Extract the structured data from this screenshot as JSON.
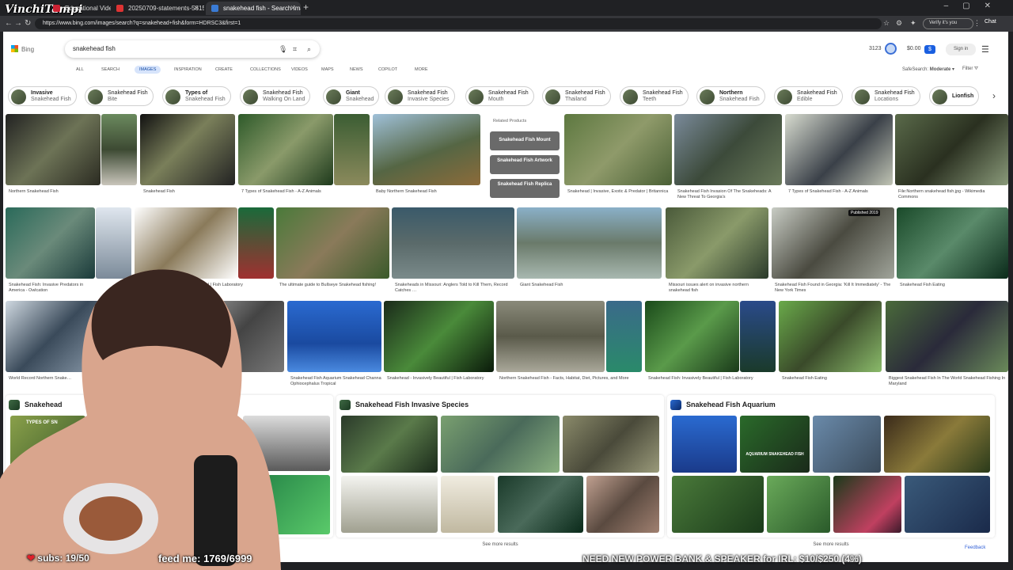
{
  "browser": {
    "tabs": [
      {
        "label": "Educational Video Questions and …"
      },
      {
        "label": "20250709-statements-5615-.pdf"
      },
      {
        "label": "snakehead fish - Search Images"
      }
    ],
    "url": "https://www.bing.com/images/search?q=snakehead+fish&form=HDRSC3&first=1",
    "verify_label": "Verify it's you",
    "chat_label": "Chat"
  },
  "bing": {
    "logo_label": "Bing",
    "query": "snakehead fish",
    "points": "3123",
    "balance": "$0.00",
    "signin": "Sign in",
    "scopes": [
      "ALL",
      "SEARCH",
      "IMAGES",
      "Inspiration",
      "Create",
      "Collections",
      "VIDEOS",
      "MAPS",
      "NEWS",
      "COPILOT",
      "MORE"
    ],
    "safesearch_label": "SafeSearch:",
    "safesearch_value": "Moderate",
    "filter_label": "Filter"
  },
  "pills": [
    {
      "a": "Invasive",
      "b": "Snakehead Fish"
    },
    {
      "a": "Snakehead Fish",
      "b": "Bite"
    },
    {
      "a": "Types of",
      "b": "Snakehead Fish"
    },
    {
      "a": "Snakehead Fish",
      "b": "Walking On Land"
    },
    {
      "a": "Giant",
      "b": "Snakehead"
    },
    {
      "a": "Snakehead Fish",
      "b": "Invasive Species"
    },
    {
      "a": "Snakehead Fish",
      "b": "Mouth"
    },
    {
      "a": "Snakehead Fish",
      "b": "Thailand"
    },
    {
      "a": "Snakehead Fish",
      "b": "Teeth"
    },
    {
      "a": "Northern",
      "b": "Snakehead Fish"
    },
    {
      "a": "Snakehead Fish",
      "b": "Edible"
    },
    {
      "a": "Snakehead Fish",
      "b": "Locations"
    },
    {
      "a": "Lionfish",
      "b": ""
    }
  ],
  "related": {
    "header": "Related Products",
    "items": [
      "Snakehead Fish Mount",
      "Snakehead Fish Artwork",
      "Snakehead Fish Replica"
    ]
  },
  "captions": {
    "r1": [
      "Northern Snakehead Fish",
      "Snakehead Fish",
      "7 Types of Snakehead Fish - A-Z Animals",
      "Baby Northern Snakehead Fish",
      "Snakehead | Invasive, Exotic & Predator | Britannica",
      "Snakehead Fish Invasion Of The Snakeheads: A New Threat To Georgia's",
      "7 Types of Snakehead Fish - A-Z Animals",
      "File:Northern snakehead fish.jpg - Wikimedia Commons"
    ],
    "r2": [
      "Snakehead Fish: Invasive Predators in America - Owlcation",
      "…autiful | Fish Laboratory",
      "The ultimate guide to Bullseye Snakehead fishing!",
      "Snakeheads in Missouri: Anglers Told to Kill Them, Record Catches …",
      "Giant Snakehead Fish",
      "Missouri issues alert on invasive northern snakehead fish",
      "Snakehead Fish Found in Georgia: 'Kill It Immediately' - The New York Times",
      "Snakehead Fish Eating"
    ],
    "r3": [
      "World Record Northern Snake…",
      "Snakehead Fish Aquarium Snakehead Channa Ophiocephalus Tropical",
      "Snakehead - Invasively Beautiful | Fish Laboratory",
      "Northern Snakehead Fish - Facts, Habitat, Diet, Pictures, and More",
      "Snakehead Fish: Invasively Beautiful | Fish Laboratory",
      "Snakehead Fish Eating",
      "Biggest Snakehead Fish In The World Snakehead Fishing In Maryland"
    ]
  },
  "badge": "Published 2019",
  "cards": [
    {
      "title": "Snakehead",
      "more": ""
    },
    {
      "title": "Snakehead Fish Invasive Species",
      "more": "See more results"
    },
    {
      "title": "Snakehead Fish Aquarium",
      "more": "See more results"
    }
  ],
  "card_image_labels": {
    "types_text": "TYPES OF SN",
    "aquarium_text": "AQUARIUM SNAKEHEAD FISH"
  },
  "feedback": "Feedback",
  "stream": {
    "watermark": "VinchiTampi",
    "subs": "subs: 19/50",
    "feed": "feed me: 1769/6999",
    "ticker": "NEED NEW POWER BANK & SPEAKER for IRL: $10/$250 (4%)"
  },
  "colors": {
    "accent": "#174ea6",
    "brand": "#1a5fe0",
    "pill_border": "#d0d0d0"
  }
}
